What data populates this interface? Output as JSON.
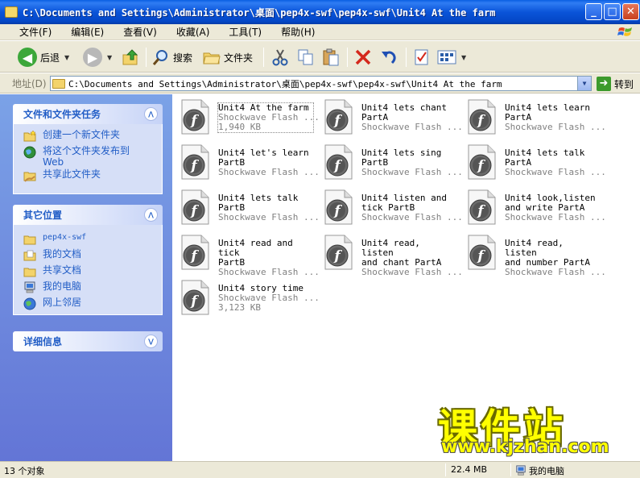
{
  "window": {
    "title": "C:\\Documents and Settings\\Administrator\\桌面\\pep4x-swf\\pep4x-swf\\Unit4 At the farm",
    "min_glyph": "_",
    "max_glyph": "□",
    "close_glyph": "✕"
  },
  "menu": [
    "文件(F)",
    "编辑(E)",
    "查看(V)",
    "收藏(A)",
    "工具(T)",
    "帮助(H)"
  ],
  "toolbar": {
    "back_label": "后退",
    "search_label": "搜索",
    "folders_label": "文件夹"
  },
  "address": {
    "label": "地址(D)",
    "path": "C:\\Documents and Settings\\Administrator\\桌面\\pep4x-swf\\pep4x-swf\\Unit4 At the farm",
    "go_label": "转到"
  },
  "tasks_panel": {
    "title": "文件和文件夹任务",
    "items": [
      {
        "label": "创建一个新文件夹",
        "icon": "new-folder-icon"
      },
      {
        "label": "将这个文件夹发布到\nWeb",
        "icon": "publish-web-icon"
      },
      {
        "label": "共享此文件夹",
        "icon": "share-folder-icon"
      }
    ]
  },
  "other_places_panel": {
    "title": "其它位置",
    "items": [
      {
        "label": "pep4x-swf",
        "icon": "folder-icon"
      },
      {
        "label": "我的文档",
        "icon": "my-documents-icon"
      },
      {
        "label": "共享文档",
        "icon": "shared-documents-icon"
      },
      {
        "label": "我的电脑",
        "icon": "my-computer-icon"
      },
      {
        "label": "网上邻居",
        "icon": "network-icon"
      }
    ]
  },
  "details_panel": {
    "title": "详细信息"
  },
  "files": [
    {
      "name": "Unit4 At the farm",
      "type": "Shockwave Flash ...",
      "size": "1,940 KB",
      "selected": true
    },
    {
      "name": "Unit4 lets chant\nPartA",
      "type": "Shockwave Flash ...",
      "size": ""
    },
    {
      "name": "Unit4 lets learn\nPartA",
      "type": "Shockwave Flash ...",
      "size": ""
    },
    {
      "name": "Unit4 let's learn\nPartB",
      "type": "Shockwave Flash ...",
      "size": ""
    },
    {
      "name": "Unit4 lets sing\nPartB",
      "type": "Shockwave Flash ...",
      "size": ""
    },
    {
      "name": "Unit4 lets talk\nPartA",
      "type": "Shockwave Flash ...",
      "size": ""
    },
    {
      "name": "Unit4 lets talk\nPartB",
      "type": "Shockwave Flash ...",
      "size": ""
    },
    {
      "name": "Unit4 listen and\ntick PartB",
      "type": "Shockwave Flash ...",
      "size": ""
    },
    {
      "name": "Unit4 look,listen\nand write PartA",
      "type": "Shockwave Flash ...",
      "size": ""
    },
    {
      "name": "Unit4 read and tick\nPartB",
      "type": "Shockwave Flash ...",
      "size": ""
    },
    {
      "name": "Unit4 read, listen\nand chant PartA",
      "type": "Shockwave Flash ...",
      "size": ""
    },
    {
      "name": "Unit4 read, listen\nand number PartA",
      "type": "Shockwave Flash ...",
      "size": ""
    },
    {
      "name": "Unit4 story time",
      "type": "Shockwave Flash ...",
      "size": "3,123 KB"
    }
  ],
  "watermark": {
    "cn": "课件站",
    "url": "www.kjzhan.com"
  },
  "status": {
    "count": "13 个对象",
    "size": "22.4 MB",
    "location": "我的电脑"
  }
}
